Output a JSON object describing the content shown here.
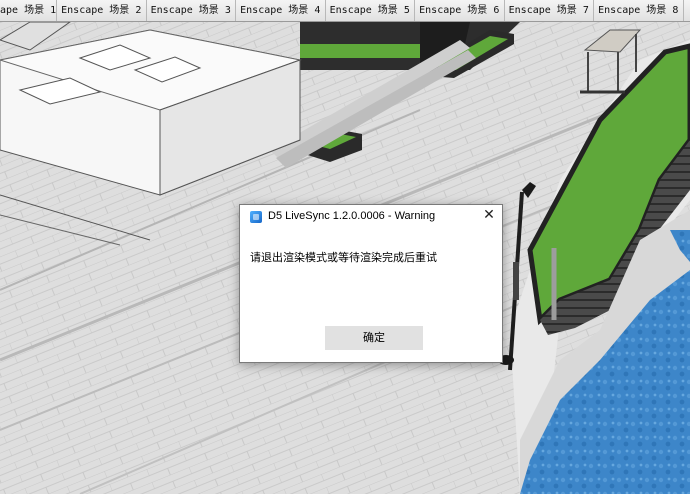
{
  "scene_tabs": [
    "ape 场景 1",
    "Enscape 场景 2",
    "Enscape 场景 3",
    "Enscape 场景 4",
    "Enscape 场景 5",
    "Enscape 场景 6",
    "Enscape 场景 7",
    "Enscape 场景 8"
  ],
  "dialog": {
    "title": "D5 LiveSync 1.2.0.0006 - Warning",
    "message": "请退出渲染模式或等待渲染完成后重试",
    "ok_label": "确定",
    "close_glyph": "✕",
    "icon": "d5-livesync-app-icon"
  },
  "colors": {
    "pavement": "#dedede",
    "grass": "#5fa83a",
    "water": "#3d86c9",
    "building": "#f7f7f7"
  }
}
